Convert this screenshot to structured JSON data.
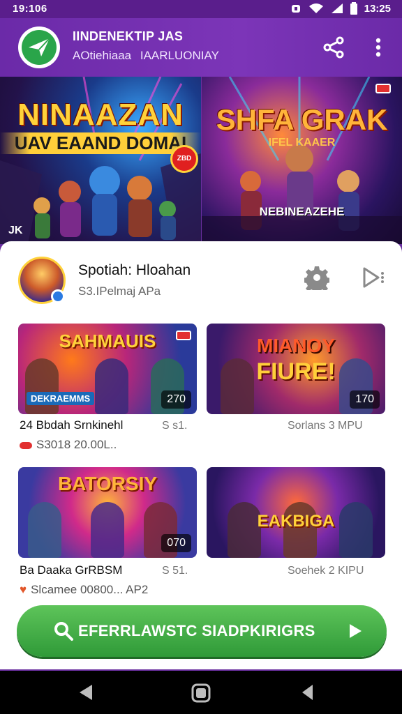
{
  "status_bar": {
    "time_left": "19:106",
    "time_right": "13:25"
  },
  "app_bar": {
    "title": "IINDENEKTIP JAS",
    "subtitle_left": "AOtiehiaaa",
    "subtitle_right": "IAARLUONIAY",
    "icons": [
      "app-logo-icon",
      "share-icon",
      "more-vert-icon"
    ]
  },
  "hero": [
    {
      "title": "NINAAZAN",
      "subtitle": "UAV EAAND DOMAI",
      "badge": "JK",
      "seal_text": "ZBD"
    },
    {
      "title": "SHFA GRAK",
      "subtitle": "IFEL   KAAER",
      "tag": "NEBINEAZEHE"
    }
  ],
  "developer": {
    "name": "Spotiah: Hloahan",
    "sub": "S3.IPelmaj APa",
    "icons": [
      "gear-icon",
      "play-outline-icon"
    ]
  },
  "cards": [
    {
      "art_title": "SAHMAUIS",
      "art_tag": "DEKRAEMMS",
      "badge": "270",
      "title": "24 Bbdah Srnkinehl",
      "meta": "S s1.",
      "row2": "S3018 20.00L.."
    },
    {
      "art_title": "MIANOY",
      "art_title2": "FIURE!",
      "badge": "170",
      "meta": "Sorlans 3 MPU"
    },
    {
      "art_title": "BATORSIY",
      "badge": "070",
      "title": "Ba Daaka GrRBSM",
      "meta": "S 51.",
      "row2": "Slcamee 00800... AP2"
    },
    {
      "art_title": "EAKBIGA",
      "meta": "Soehek 2 KIPU"
    }
  ],
  "cta": {
    "label": "EFERRLAWSTC SIADPKIRIGRS",
    "icons": [
      "search-icon",
      "play-icon"
    ]
  },
  "colors": {
    "app_bar": "#6b2aa8",
    "status_bar": "#5a1e8c",
    "cta": "#3aa844",
    "panel": "#ffffff"
  }
}
